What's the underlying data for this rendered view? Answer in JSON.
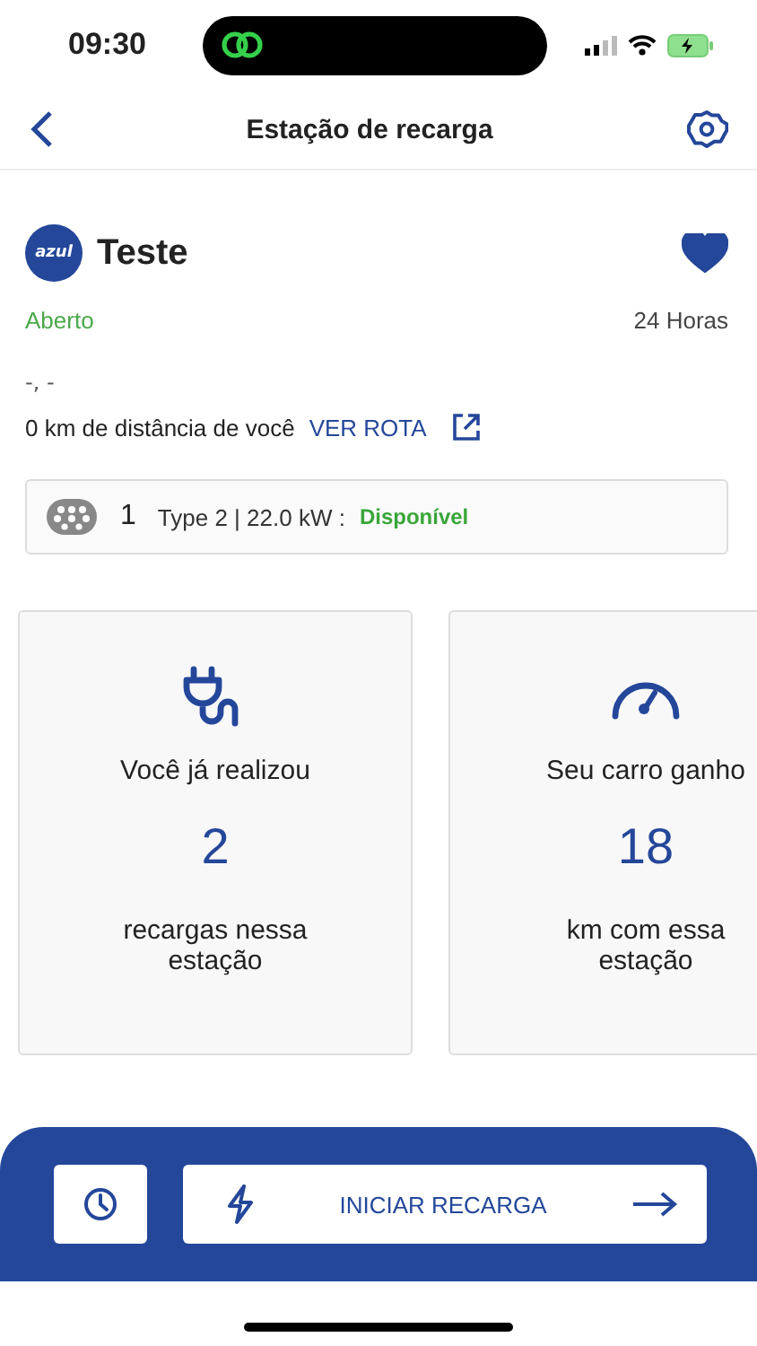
{
  "status_bar": {
    "time": "09:30"
  },
  "header": {
    "title": "Estação de recarga"
  },
  "station": {
    "logo_text": "azul",
    "name": "Teste",
    "favorite": true,
    "status": "Aberto",
    "hours": "24 Horas",
    "address": "-, -",
    "distance": "0 km de distância de você",
    "route_link": "VER ROTA"
  },
  "connectors": [
    {
      "count": "1",
      "description": "Type 2 | 22.0 kW :",
      "availability": "Disponível"
    }
  ],
  "stats": [
    {
      "kind": "plug",
      "label": "Você já realizou",
      "value": "2",
      "caption": "recargas nessa estação"
    },
    {
      "kind": "gauge",
      "label": "Seu carro ganho",
      "value": "18",
      "caption": "km com essa estação"
    }
  ],
  "bottom_bar": {
    "start_button": "INICIAR RECARGA"
  }
}
